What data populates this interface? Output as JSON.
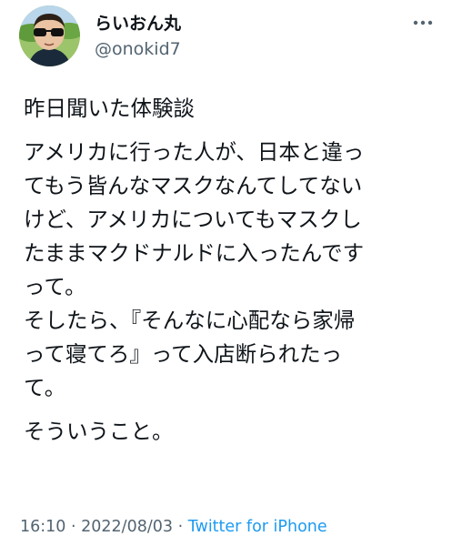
{
  "author": {
    "display_name": "らいおん丸",
    "handle": "@onokid7"
  },
  "tweet": {
    "intro": "昨日聞いた体験談",
    "body_lines": [
      "アメリカに行った人が、日本と違っ",
      "てもう皆んなマスクなんてしてない",
      "けど、アメリカについてもマスクし",
      "たままマクドナルドに入ったんです",
      "って。",
      "そしたら、『そんなに心配なら家帰",
      "って寝てろ』って入店断られたっ",
      "て。"
    ],
    "closing": "そういうこと。"
  },
  "meta": {
    "time": "16:10",
    "separator_1": " · ",
    "date": "2022/08/03",
    "separator_2": " · ",
    "source": "Twitter for iPhone"
  },
  "icons": {
    "more": "more-horizontal-icon"
  },
  "colors": {
    "text": "#0f1419",
    "secondary": "#536471",
    "link": "#1d9bf0"
  }
}
